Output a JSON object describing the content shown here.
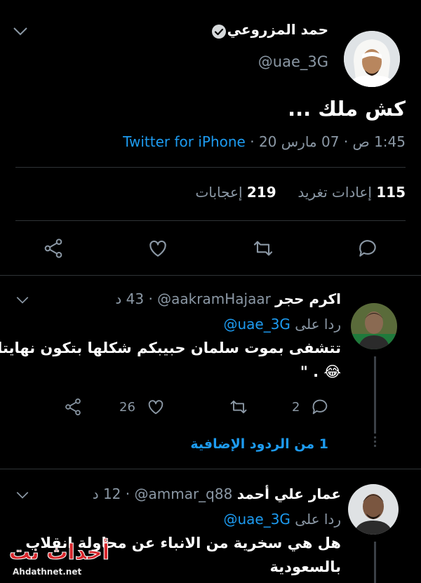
{
  "main_tweet": {
    "display_name": "حمد المزروعي",
    "handle": "@uae_3G",
    "text": "كش ملك ...",
    "time": "1:45 ص",
    "date": "07 مارس 20",
    "source": "Twitter for iPhone",
    "retweets_count": "115",
    "retweets_label": "إعادات تغريد",
    "likes_count": "219",
    "likes_label": "إعجابات"
  },
  "replies": [
    {
      "display_name": "اكرم حجر",
      "handle": "@aakramHajaar",
      "time": "43 د",
      "reply_to_label": "ردا على",
      "reply_to_handle": "@uae_3G",
      "text_line1": "تتشفى بموت سلمان حبيبكم شكلها بتكون نهايتك",
      "text_line2": "\" . 😂",
      "likes": "26",
      "replies": "2",
      "more_replies": "1 من الردود الإضافية"
    },
    {
      "display_name": "عمار علي أحمد",
      "handle": "@ammar_q88",
      "time": "12 د",
      "reply_to_label": "ردا على",
      "reply_to_handle": "@uae_3G",
      "text_line1": "هل هي سخرية من الانباء عن محاولة انقلاب",
      "text_line2": "بالسعودية"
    }
  ],
  "watermark": {
    "logo_text": "أحداث نت",
    "url": "Ahdathnet.net"
  },
  "colors": {
    "background": "#000000",
    "accent": "#1d9bf0",
    "muted": "#8b98a5",
    "divider": "#2f3336",
    "watermark_red": "#d7262b"
  }
}
